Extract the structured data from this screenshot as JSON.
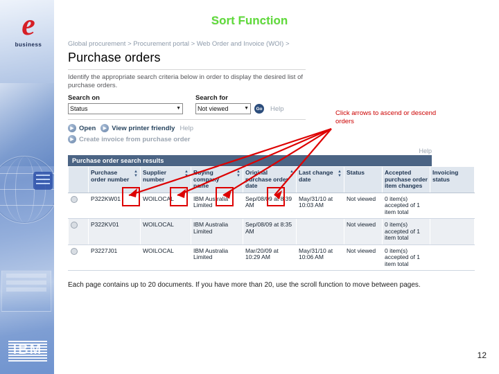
{
  "slide": {
    "title": "Sort Function",
    "title_color": "#5fdb3a",
    "page_number": "12",
    "footnote": "Each page contains up to 20 documents. If you have more than 20, use the scroll function to move between pages.",
    "brand_top": {
      "mark": "e",
      "sub": "business"
    },
    "brand_bottom": "IBM"
  },
  "annotation": {
    "text": "Click arrows to ascend or descend orders",
    "color": "#cc0000"
  },
  "app": {
    "breadcrumb": "Global procurement > Procurement portal > Web Order and Invoice (WOI) >",
    "page_title": "Purchase orders",
    "intro": "Identify the appropriate search criteria below in order to display the desired list of purchase orders.",
    "search": {
      "on_label": "Search on",
      "on_value": "Status",
      "for_label": "Search for",
      "for_value": "Not viewed",
      "go_label": "Go",
      "help_label": "Help"
    },
    "actions": [
      {
        "label": "Open",
        "muted": false
      },
      {
        "label": "View printer friendly",
        "muted": false
      },
      {
        "label": "Help",
        "muted": true
      }
    ],
    "action_secondary": {
      "label": "Create invoice from purchase order"
    },
    "results": {
      "help_label": "Help",
      "caption": "Purchase order search results",
      "columns": [
        {
          "label": "",
          "sortable": false
        },
        {
          "label": "Purchase order number",
          "sortable": true
        },
        {
          "label": "Supplier number",
          "sortable": true
        },
        {
          "label": "Buying company name",
          "sortable": true
        },
        {
          "label": "Original purchase order date",
          "sortable": true
        },
        {
          "label": "Last change date",
          "sortable": true
        },
        {
          "label": "Status",
          "sortable": false
        },
        {
          "label": "Accepted purchase order item changes",
          "sortable": false
        },
        {
          "label": "Invoicing status",
          "sortable": false
        }
      ],
      "rows": [
        {
          "po_number": "P322KW01",
          "supplier_number": "WOILOCAL",
          "buying_company": "IBM Australia Limited",
          "original_date": "Sep/08/09 at 8:39 AM",
          "last_change_date": "May/31/10 at 10:03 AM",
          "status": "Not viewed",
          "accepted_changes": "0 item(s) accepted of 1 item total",
          "invoicing_status": ""
        },
        {
          "po_number": "P322KV01",
          "supplier_number": "WOILOCAL",
          "buying_company": "IBM Australia Limited",
          "original_date": "Sep/08/09 at 8:35 AM",
          "last_change_date": "",
          "status": "Not viewed",
          "accepted_changes": "0 item(s) accepted of 1 item total",
          "invoicing_status": ""
        },
        {
          "po_number": "P3227J01",
          "supplier_number": "WOILOCAL",
          "buying_company": "IBM Australia Limited",
          "original_date": "Mar/20/09 at 10:29 AM",
          "last_change_date": "May/31/10 at 10:06 AM",
          "status": "Not viewed",
          "accepted_changes": "0 item(s) accepted of 1 item total",
          "invoicing_status": ""
        }
      ]
    }
  }
}
